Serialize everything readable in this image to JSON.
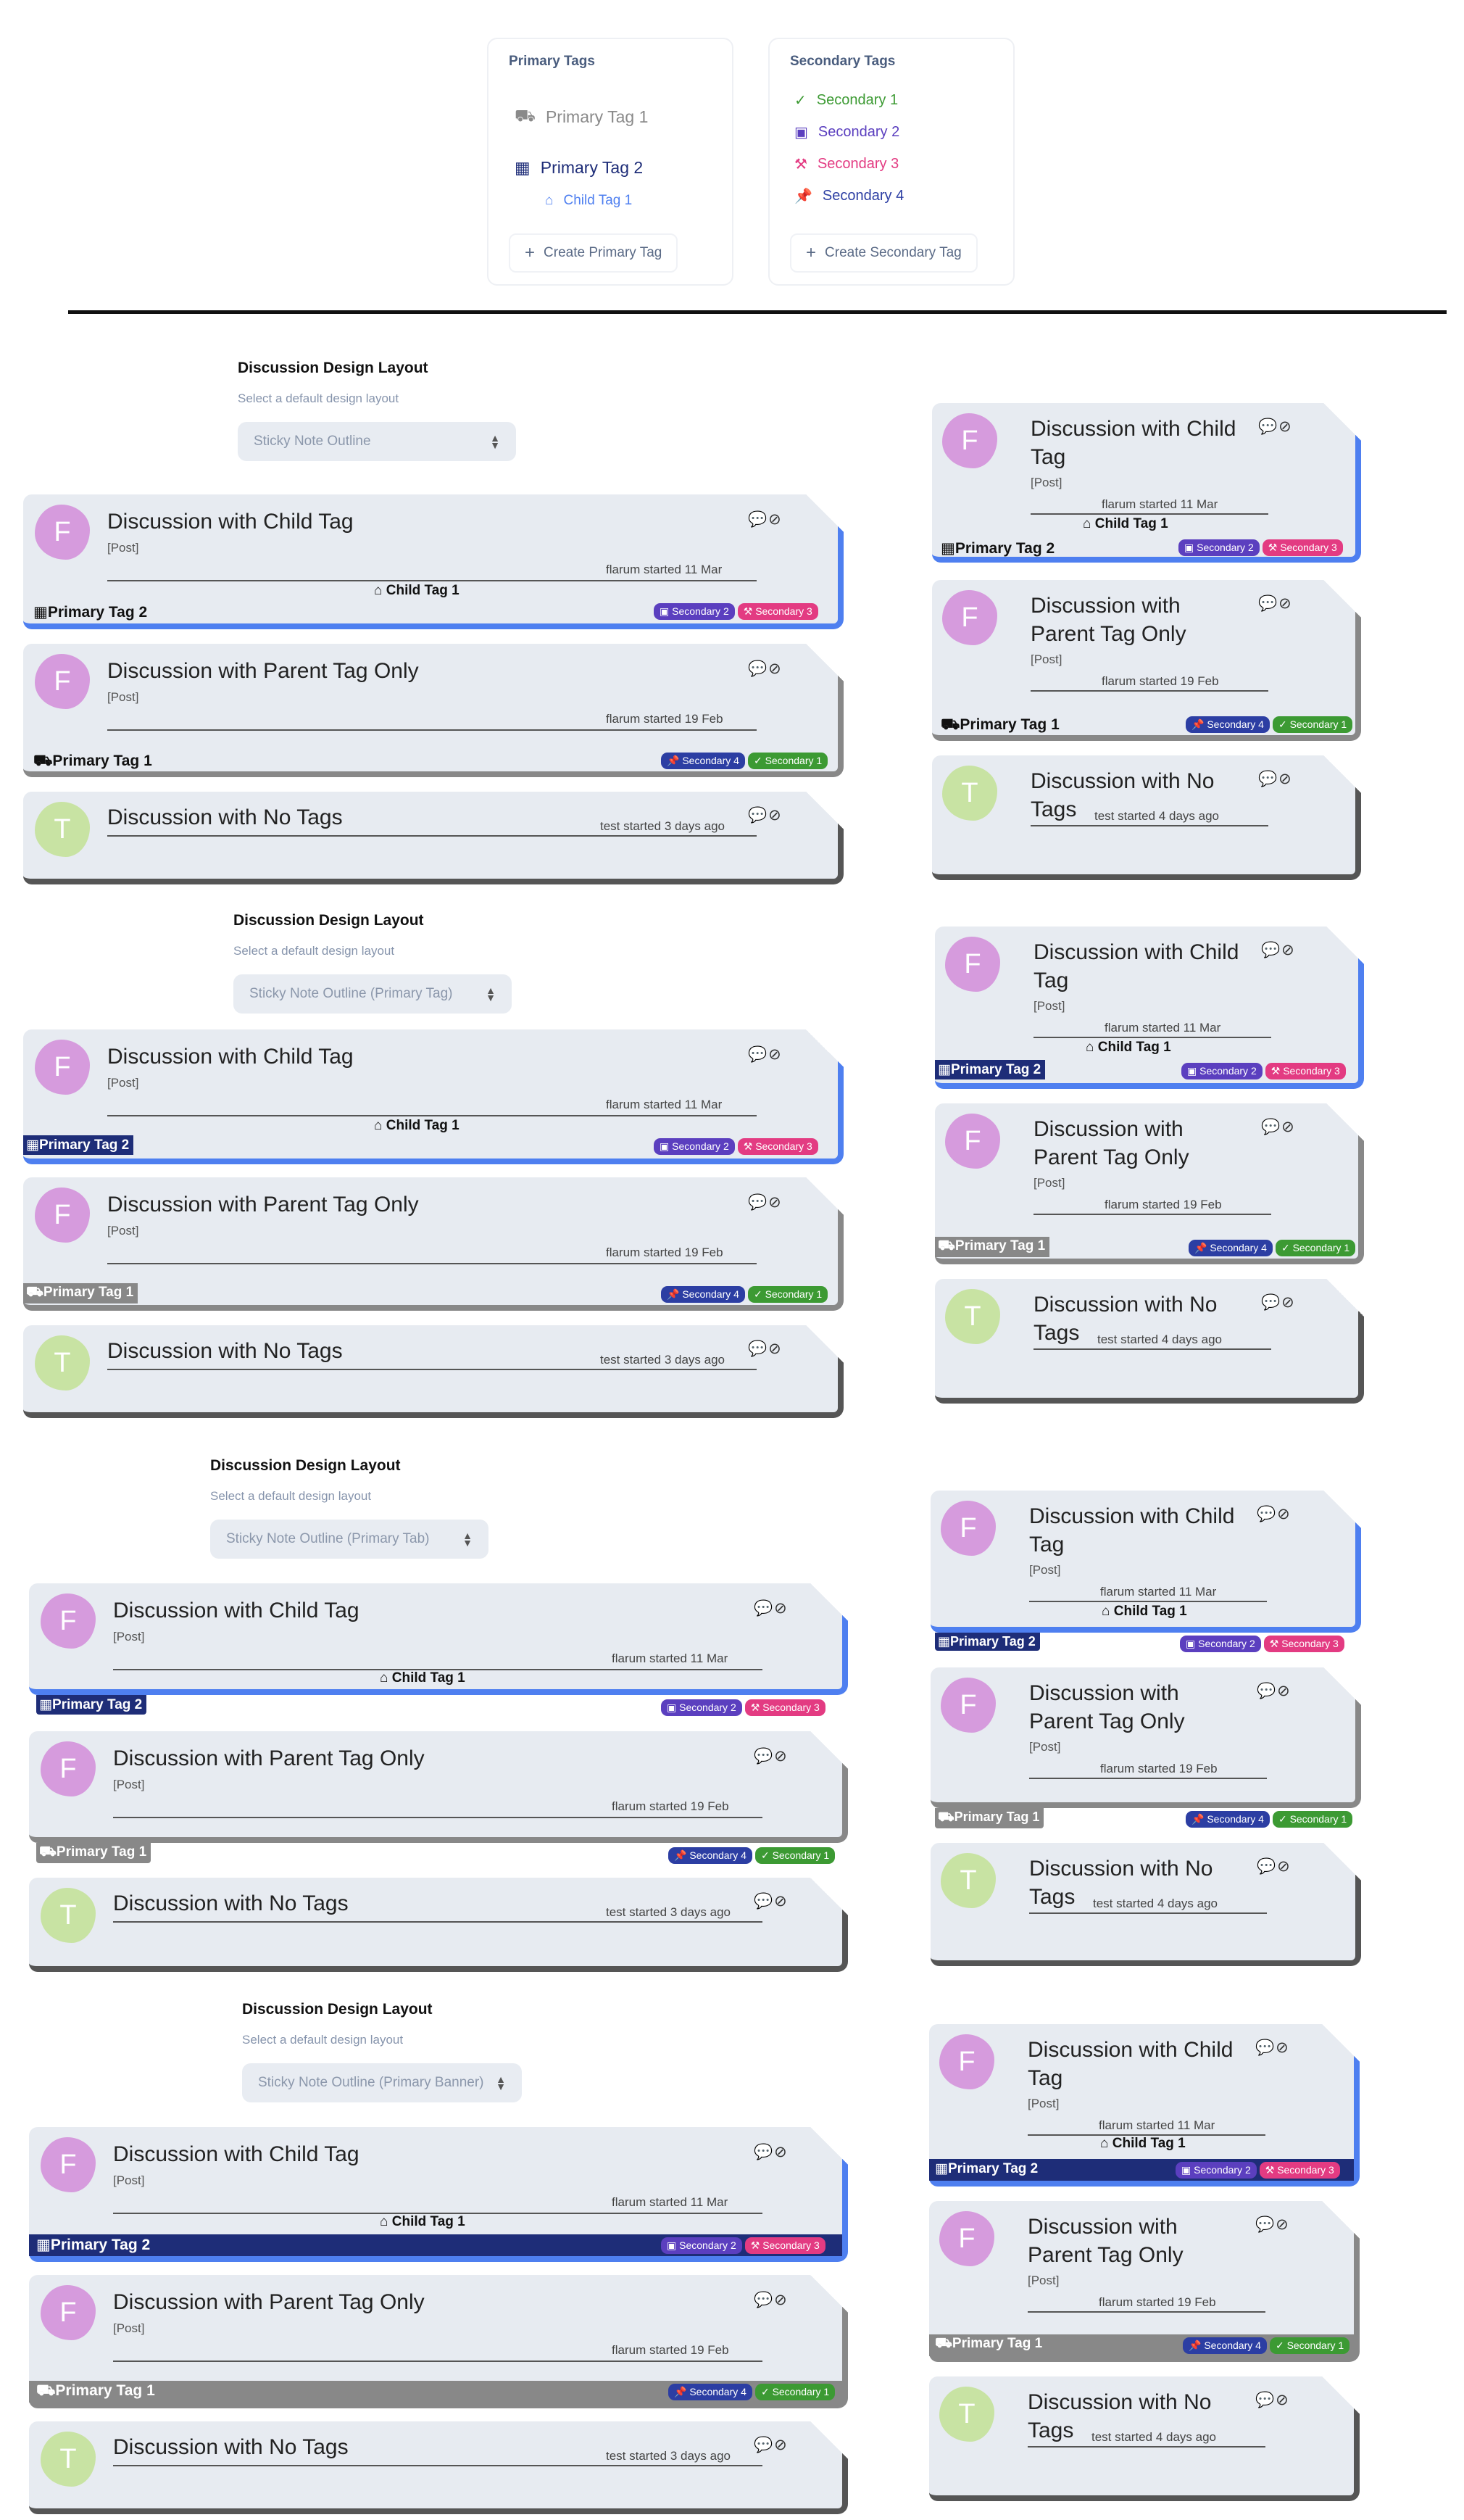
{
  "primary_panel": {
    "title": "Primary Tags",
    "items": [
      {
        "label": "Primary Tag 1",
        "icon": "cart-flatbed-icon",
        "color": "#8a8a8a"
      },
      {
        "label": "Primary Tag 2",
        "icon": "building-icon",
        "color": "#1e2d78"
      },
      {
        "label": "Child Tag 1",
        "icon": "store-icon",
        "color": "#4e7ff0"
      }
    ],
    "create": "Create Primary Tag"
  },
  "secondary_panel": {
    "title": "Secondary Tags",
    "items": [
      {
        "label": "Secondary 1",
        "icon": "check-icon",
        "color": "#3c9a33"
      },
      {
        "label": "Secondary 2",
        "icon": "calendar-icon",
        "color": "#5b3fbf"
      },
      {
        "label": "Secondary 3",
        "icon": "hammer-icon",
        "color": "#e33b82"
      },
      {
        "label": "Secondary 4",
        "icon": "thumbtack-icon",
        "color": "#2c3ea3"
      }
    ],
    "create": "Create Secondary Tag"
  },
  "settings": {
    "title": "Discussion Design Layout",
    "help": "Select a default design layout",
    "options": [
      "Sticky Note Outline",
      "Sticky Note Outline (Primary Tag)",
      "Sticky Note Outline (Primary Tab)",
      "Sticky Note Outline (Primary Banner)"
    ]
  },
  "discussions": {
    "child": {
      "title": "Discussion with Child Tag",
      "title_a": "Discussion with Child",
      "title_b": "Tag",
      "type": "[Post]",
      "started": "flarum started 11 Mar",
      "child_tag": "Child Tag 1",
      "primary": "Primary Tag 2",
      "badges": [
        "Secondary 2",
        "Secondary 3"
      ],
      "avatar": "F"
    },
    "parent": {
      "title": "Discussion with Parent Tag Only",
      "title_a": "Discussion with",
      "title_b": "Parent Tag Only",
      "type": "[Post]",
      "started": "flarum started 19 Feb",
      "primary": "Primary Tag 1",
      "badges": [
        "Secondary 4",
        "Secondary 1"
      ],
      "avatar": "F"
    },
    "none": {
      "title": "Discussion with No Tags",
      "title_a": "Discussion with No",
      "title_b": "Tags",
      "started": "test started 3 days ago",
      "started_narrow": "test started 4 days ago",
      "avatar": "T"
    }
  },
  "icons": {
    "comment": "comment-icon",
    "attach": "paperclip-icon"
  }
}
